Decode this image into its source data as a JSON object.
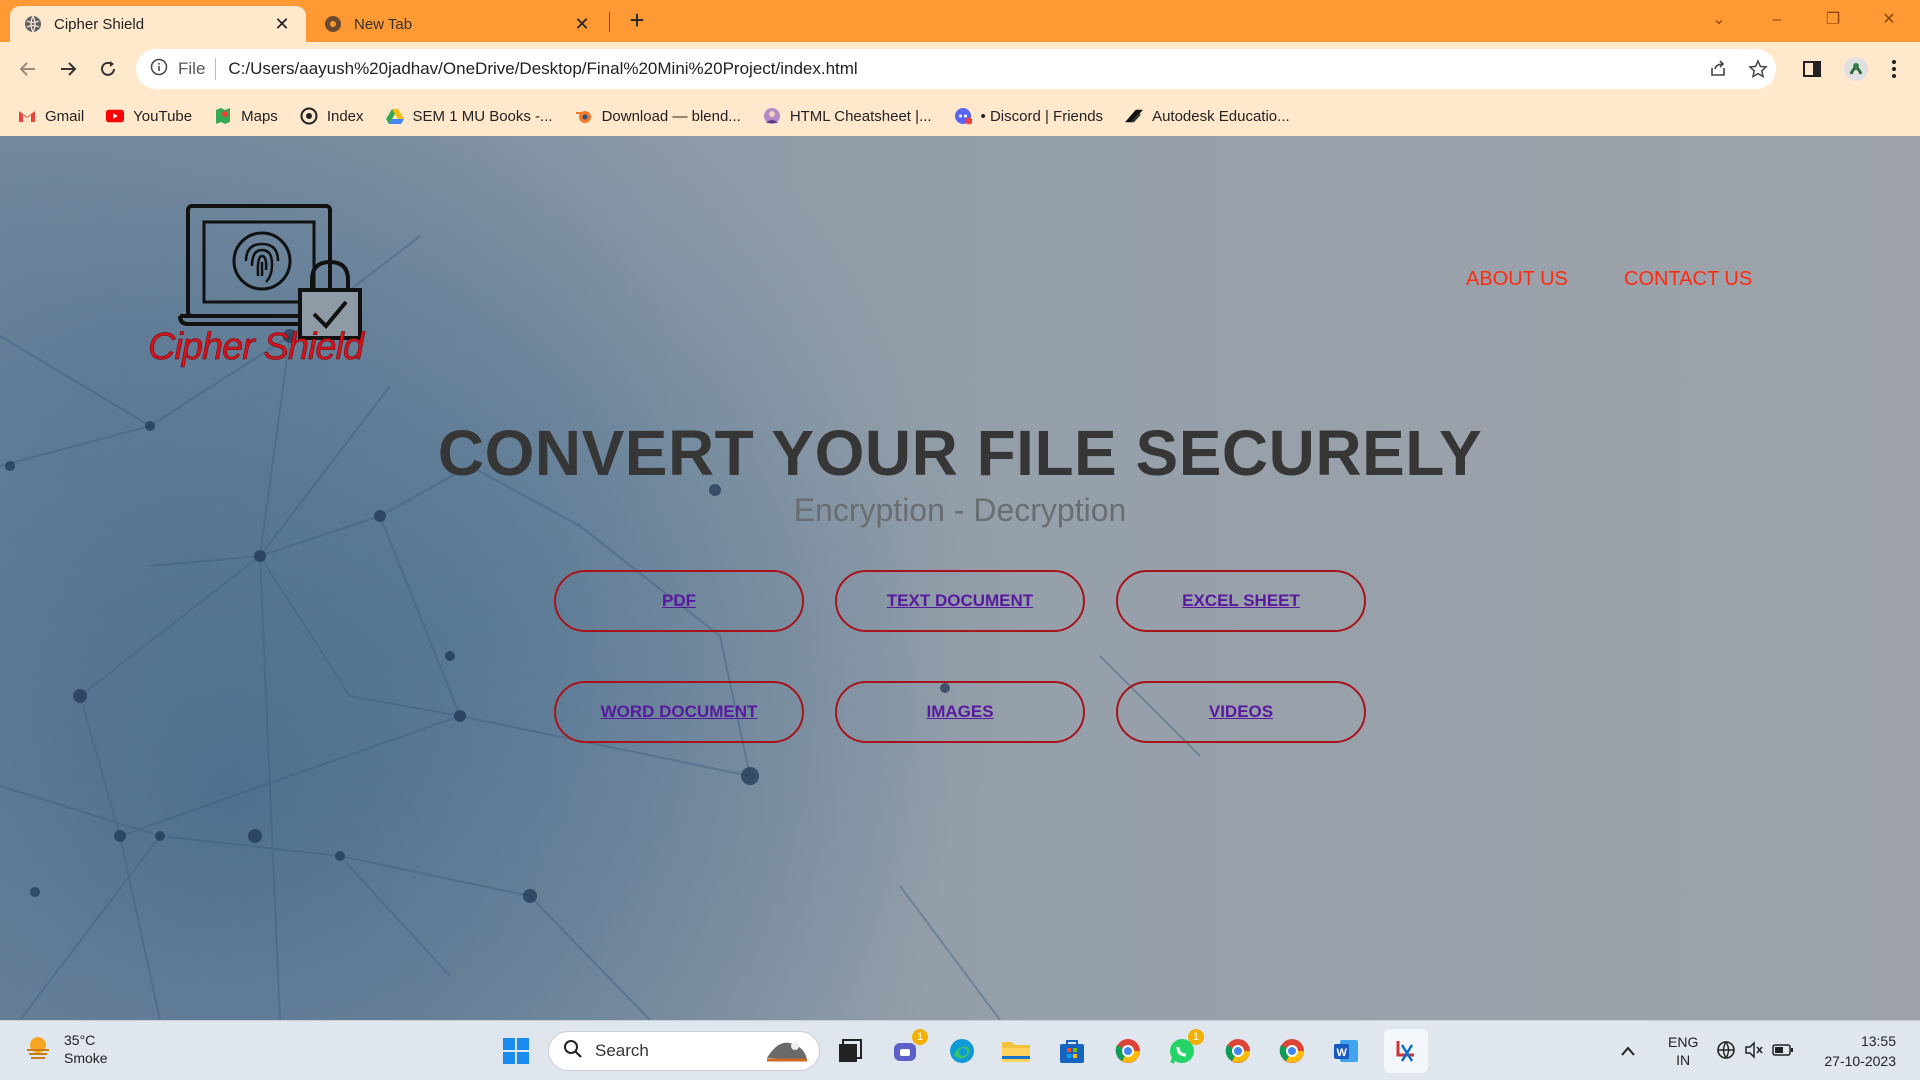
{
  "browser": {
    "tabs": [
      {
        "title": "Cipher Shield",
        "active": true
      },
      {
        "title": "New Tab",
        "active": false
      }
    ],
    "address": {
      "scheme_label": "File",
      "url": "C:/Users/aayush%20jadhav/OneDrive/Desktop/Final%20Mini%20Project/index.html"
    },
    "bookmarks": [
      {
        "label": "Gmail",
        "icon": "gmail-icon"
      },
      {
        "label": "YouTube",
        "icon": "youtube-icon"
      },
      {
        "label": "Maps",
        "icon": "maps-icon"
      },
      {
        "label": "Index",
        "icon": "index-icon"
      },
      {
        "label": "SEM 1 MU Books -...",
        "icon": "drive-icon"
      },
      {
        "label": "Download — blend...",
        "icon": "blender-icon"
      },
      {
        "label": "HTML Cheatsheet |...",
        "icon": "avatar-icon"
      },
      {
        "label": "• Discord | Friends",
        "icon": "discord-icon"
      },
      {
        "label": "Autodesk Educatio...",
        "icon": "autodesk-icon"
      }
    ]
  },
  "site": {
    "logo_text": "Cipher Shield",
    "nav": {
      "about": "ABOUT US",
      "contact": "CONTACT US"
    },
    "headline": "CONVERT YOUR FILE SECURELY",
    "subheadline": "Encryption - Decryption",
    "file_buttons": [
      "PDF",
      "TEXT DOCUMENT",
      "EXCEL SHEET",
      "WORD DOCUMENT",
      "IMAGES",
      "VIDEOS"
    ],
    "colors": {
      "brand_red": "#d4141c",
      "nav_red": "#ff2a10",
      "button_border": "#a8141c",
      "link_purple": "#5a1aa0",
      "headline": "#363636"
    }
  },
  "taskbar": {
    "weather": {
      "temp": "35°C",
      "condition": "Smoke"
    },
    "search_placeholder": "Search",
    "badges": {
      "teams": "1",
      "whatsapp": "1"
    },
    "tray": {
      "lang": "ENG",
      "region": "IN"
    },
    "clock": {
      "time": "13:55",
      "date": "27-10-2023"
    }
  }
}
